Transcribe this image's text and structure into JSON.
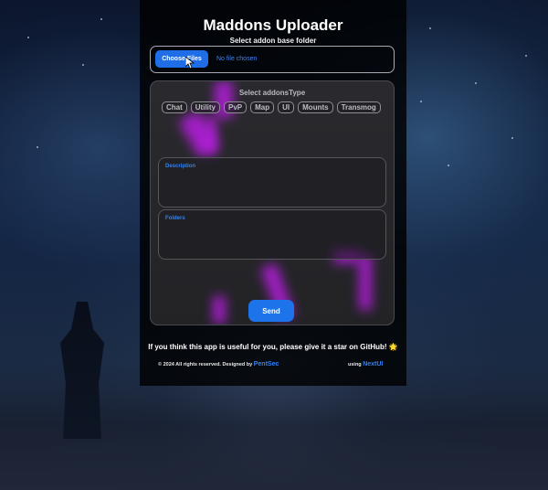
{
  "app": {
    "title": "Maddons Uploader",
    "subtitle": "Select addon base folder"
  },
  "file_input": {
    "button_label": "Choose Files",
    "status": "No file chosen"
  },
  "addon_type": {
    "title": "Select addonsType",
    "chips": [
      "Chat",
      "Utility",
      "PvP",
      "Map",
      "UI",
      "Mounts",
      "Transmog"
    ]
  },
  "fields": {
    "description_label": "Description",
    "folders_label": "Folders"
  },
  "send_label": "Send",
  "note": "If you think this app is useful for you, please give it a star on GitHub! 🌟",
  "footer": {
    "rights": "© 2024 All rights reserved. Designed by",
    "designer": "PentSec",
    "using": "using",
    "lib": "NextUI"
  },
  "colors": {
    "accent": "#1f6ee8",
    "link": "#2f82f5",
    "glow": "#b71ee0",
    "panel": "#000000"
  }
}
